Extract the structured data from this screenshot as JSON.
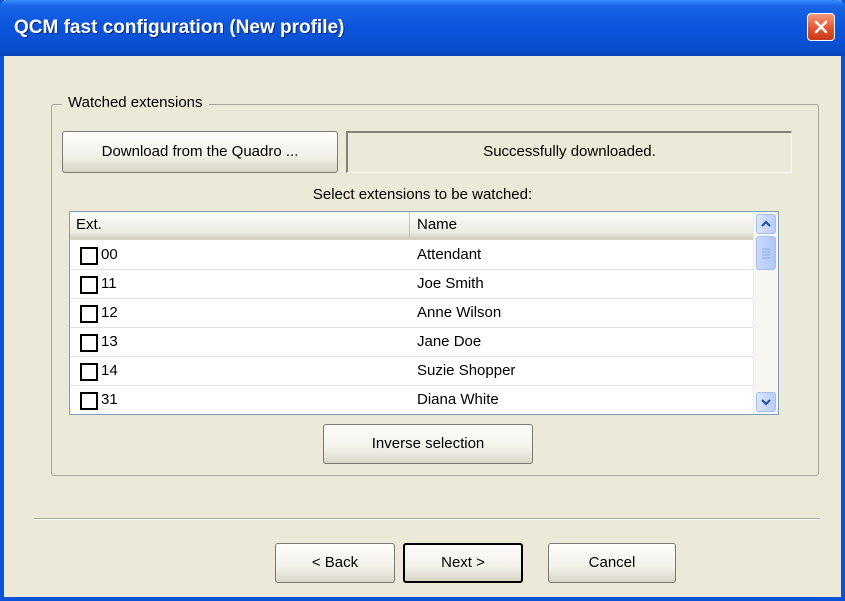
{
  "window": {
    "title": "QCM fast configuration (New profile)"
  },
  "group": {
    "legend": "Watched extensions"
  },
  "download": {
    "button_label": "Download from the Quadro ...",
    "status": "Successfully downloaded."
  },
  "select_label": "Select extensions to be watched:",
  "list": {
    "columns": {
      "ext": "Ext.",
      "name": "Name"
    },
    "rows": [
      {
        "ext": "00",
        "name": "Attendant",
        "checked": false
      },
      {
        "ext": "11",
        "name": "Joe Smith",
        "checked": false
      },
      {
        "ext": "12",
        "name": "Anne Wilson",
        "checked": false
      },
      {
        "ext": "13",
        "name": "Jane Doe",
        "checked": false
      },
      {
        "ext": "14",
        "name": "Suzie Shopper",
        "checked": false
      },
      {
        "ext": "31",
        "name": "Diana White",
        "checked": false
      }
    ]
  },
  "inverse_label": "Inverse selection",
  "footer": {
    "back_label": "< Back",
    "next_label": "Next >",
    "cancel_label": "Cancel"
  },
  "colors": {
    "titlebar": "#0a53d8",
    "dialog_bg": "#ece9d8",
    "close_button": "#e0502a"
  }
}
